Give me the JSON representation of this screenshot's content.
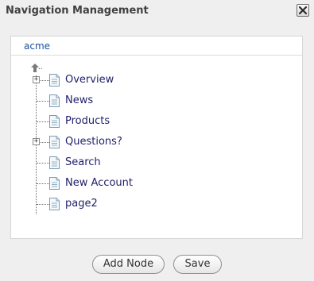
{
  "dialog": {
    "title": "Navigation Management"
  },
  "panel": {
    "site_name": "acme",
    "parent_label": ".."
  },
  "tree": {
    "nodes": [
      {
        "label": "Overview",
        "expandable": true
      },
      {
        "label": "News",
        "expandable": false
      },
      {
        "label": "Products",
        "expandable": false
      },
      {
        "label": "Questions?",
        "expandable": true
      },
      {
        "label": "Search",
        "expandable": false
      },
      {
        "label": "New Account",
        "expandable": false
      },
      {
        "label": "page2",
        "expandable": false
      }
    ]
  },
  "footer": {
    "add_node_label": "Add Node",
    "save_label": "Save"
  },
  "icons": {
    "close": "close-icon",
    "up": "up-arrow-icon",
    "page": "page-icon",
    "expander": "plus-icon"
  },
  "colors": {
    "link": "#1a4f9c",
    "node_text": "#1f1f6b",
    "dialog_bg": "#efefef"
  }
}
